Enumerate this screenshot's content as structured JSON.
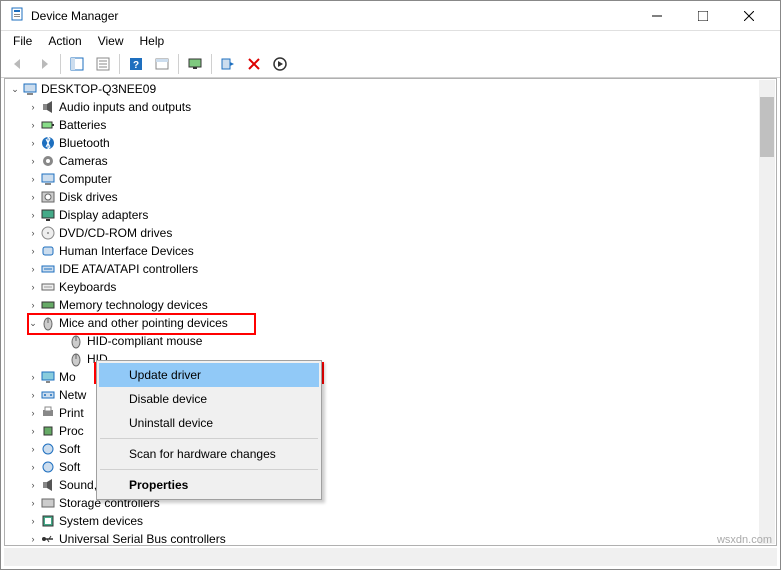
{
  "window": {
    "title": "Device Manager",
    "menus": [
      "File",
      "Action",
      "View",
      "Help"
    ]
  },
  "toolbar_icons": [
    "back",
    "forward",
    "show-hide",
    "props",
    "help",
    "view",
    "monitor",
    "scan",
    "uninstall",
    "update"
  ],
  "root": {
    "label": "DESKTOP-Q3NEE09"
  },
  "categories": [
    {
      "label": "Audio inputs and outputs",
      "icon": "audio"
    },
    {
      "label": "Batteries",
      "icon": "battery"
    },
    {
      "label": "Bluetooth",
      "icon": "bt"
    },
    {
      "label": "Cameras",
      "icon": "camera"
    },
    {
      "label": "Computer",
      "icon": "computer"
    },
    {
      "label": "Disk drives",
      "icon": "disk"
    },
    {
      "label": "Display adapters",
      "icon": "display"
    },
    {
      "label": "DVD/CD-ROM drives",
      "icon": "cd"
    },
    {
      "label": "Human Interface Devices",
      "icon": "hid"
    },
    {
      "label": "IDE ATA/ATAPI controllers",
      "icon": "ide"
    },
    {
      "label": "Keyboards",
      "icon": "kbd"
    },
    {
      "label": "Memory technology devices",
      "icon": "mem"
    }
  ],
  "expanded": {
    "label": "Mice and other pointing devices",
    "icon": "mouse",
    "children": [
      {
        "label": "HID-compliant mouse",
        "icon": "mouse"
      },
      {
        "label": "HID",
        "icon": "mouse"
      }
    ]
  },
  "after": [
    {
      "label": "Mo",
      "icon": "monitor"
    },
    {
      "label": "Netw",
      "icon": "net"
    },
    {
      "label": "Print",
      "icon": "print"
    },
    {
      "label": "Proc",
      "icon": "cpu"
    },
    {
      "label": "Soft",
      "icon": "soft"
    },
    {
      "label": "Soft",
      "icon": "soft"
    },
    {
      "label": "Sound, video and game controllers",
      "icon": "audio",
      "full": true
    },
    {
      "label": "Storage controllers",
      "icon": "storage",
      "full": true
    },
    {
      "label": "System devices",
      "icon": "sys",
      "full": true
    },
    {
      "label": "Universal Serial Bus controllers",
      "icon": "usb",
      "full": true
    }
  ],
  "context_menu": {
    "items": [
      {
        "label": "Update driver",
        "hot": true
      },
      {
        "label": "Disable device"
      },
      {
        "label": "Uninstall device"
      },
      {
        "sep": true
      },
      {
        "label": "Scan for hardware changes"
      },
      {
        "sep": true
      },
      {
        "label": "Properties",
        "bold": true
      }
    ]
  },
  "watermark": "wsxdn.com"
}
